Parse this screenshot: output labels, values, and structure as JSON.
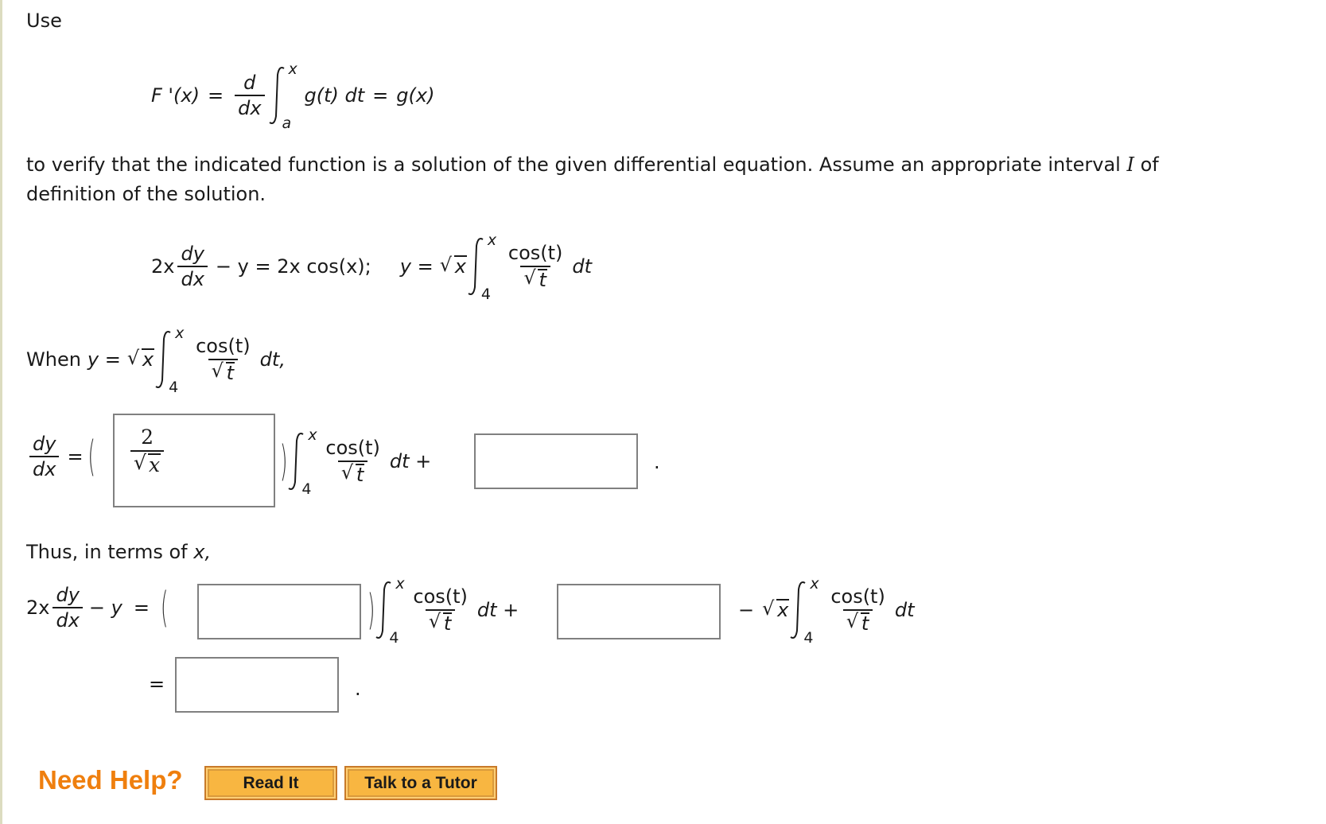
{
  "intro": {
    "use_label": "Use",
    "ftc_formula": {
      "lhs": "F '(x)",
      "eq": "=",
      "d": "d",
      "dx": "dx",
      "upper": "x",
      "lower": "a",
      "integrand": "g(t) dt",
      "eq2": "=",
      "rhs": "g(x)"
    },
    "paragraph_line1": "to verify that the indicated function is a solution of the given differential equation. Assume an appropriate interval",
    "interval_symbol": "I",
    "paragraph_of": "of",
    "paragraph_line2": "definition of the solution."
  },
  "equation": {
    "coef": "2x",
    "dy": "dy",
    "dx": "dx",
    "minus_y": "− y = 2x cos(x);",
    "y_eq": "y =",
    "sqrt_x": "x",
    "upper": "x",
    "lower": "4",
    "num": "cos(t)",
    "den": "t",
    "dt": "dt"
  },
  "when": {
    "label": "When",
    "y_eq": "y =",
    "sqrt_x": "x",
    "upper": "x",
    "lower": "4",
    "num": "cos(t)",
    "den": "t",
    "dt": "dt,"
  },
  "derivative": {
    "dy": "dy",
    "dx": "dx",
    "eq": "=",
    "answer1_num": "2",
    "answer1_den": "x",
    "upper": "x",
    "lower": "4",
    "num": "cos(t)",
    "den": "t",
    "dt_plus": "dt +",
    "answer2_value": "",
    "end": "."
  },
  "thus": {
    "label_prefix": "Thus, in terms of",
    "label_var": "x,",
    "coef": "2x",
    "dy": "dy",
    "dx": "dx",
    "minus_y": "− y",
    "eq": "=",
    "answer3_value": "",
    "upper": "x",
    "lower": "4",
    "num": "cos(t)",
    "den": "t",
    "dt_plus": "dt +",
    "answer4_value": "",
    "minus": "−",
    "sqrt_x": "x",
    "upper2": "x",
    "lower2": "4",
    "num2": "cos(t)",
    "den2": "t",
    "dt2": "dt",
    "eq2": "=",
    "answer5_value": "",
    "end": "."
  },
  "help": {
    "label": "Need Help?",
    "read_it": "Read It",
    "talk_tutor": "Talk to a Tutor"
  },
  "colors": {
    "accent_orange": "#ef7f0e",
    "button_fill": "#f8b641",
    "input_border": "#808080"
  }
}
